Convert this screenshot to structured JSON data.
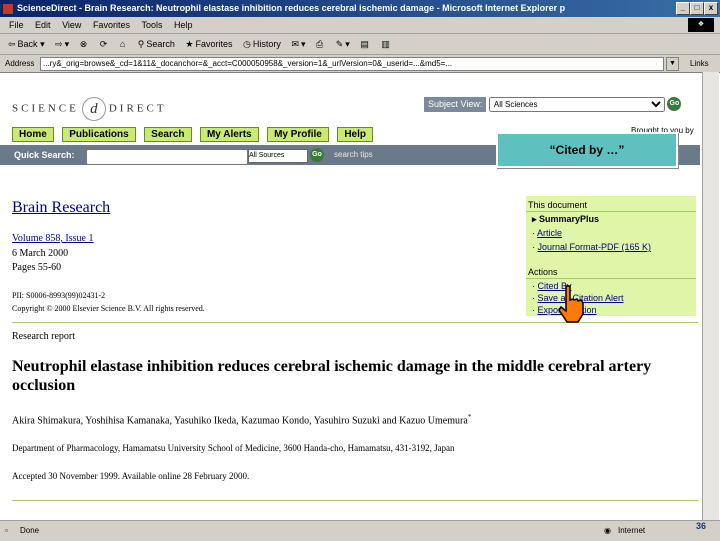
{
  "window": {
    "title": "ScienceDirect - Brain Research: Neutrophil elastase inhibition reduces cerebral ischemic damage - Microsoft Internet Explorer p",
    "min_label": "_",
    "max_label": "□",
    "close_label": "x"
  },
  "menubar": {
    "items": [
      "File",
      "Edit",
      "View",
      "Favorites",
      "Tools",
      "Help"
    ]
  },
  "toolbar": {
    "back_label": "Back",
    "search_label": "Search",
    "favorites_label": "Favorites",
    "history_label": "History"
  },
  "address": {
    "label": "Address",
    "url": "...ry&_orig=browse&_cd=1&11&_docanchor=&_acct=C000050958&_version=1&_urlVersion=0&_userid=...&md5=...",
    "links_label": "Links"
  },
  "page": {
    "logo_left": "SCIENCE",
    "logo_mid": "d",
    "logo_right": "DIRECT",
    "subject_view_label": "Subject View:",
    "subject_view_value": "All Sciences",
    "go_label": "Go",
    "nav": {
      "home": "Home",
      "publications": "Publications",
      "search": "Search",
      "my_alerts": "My Alerts",
      "my_profile": "My Profile",
      "help": "Help"
    },
    "quick_search_label": "Quick Search:",
    "within_label": "within",
    "within_value": "All Sources",
    "search_tips": "search tips",
    "brought_to_you": "Brought to you by"
  },
  "callout": {
    "text": "“Cited by …”"
  },
  "article": {
    "journal": "Brain Research",
    "volume": "Volume 858, Issue 1",
    "date": "6 March 2000",
    "pages": "Pages 55-60",
    "pii": "PII: S0006-8993(99)02431-2",
    "copyright": "Copyright © 2000 Elsevier Science B.V. All rights reserved.",
    "report_type": "Research report",
    "title": "Neutrophil elastase inhibition reduces cerebral ischemic damage in the middle cerebral artery occlusion",
    "authors": "Akira Shimakura, Yoshihisa Kamanaka, Yasuhiko Ikeda, Kazumao Kondo, Yasuhiro Suzuki and Kazuo Umemura",
    "authors_mark": "*",
    "department": "Department of Pharmacology, Hamamatsu University School of Medicine, 3600 Handa-cho, Hamamatsu, 431-3192, Japan",
    "accepted": "Accepted 30 November 1999.  Available online 28 February 2000."
  },
  "sidebar": {
    "this_document": "This document",
    "summary_plus": "SummaryPlus",
    "article_link": "Article",
    "pdf_link": "Journal Format-PDF (165 K)",
    "actions": "Actions",
    "cited_by": "Cited By",
    "save_alert": "Save as Citation Alert",
    "export_citation": "Export Citation"
  },
  "statusbar": {
    "status": "Done",
    "zone": "Internet",
    "slide_number": "36"
  }
}
